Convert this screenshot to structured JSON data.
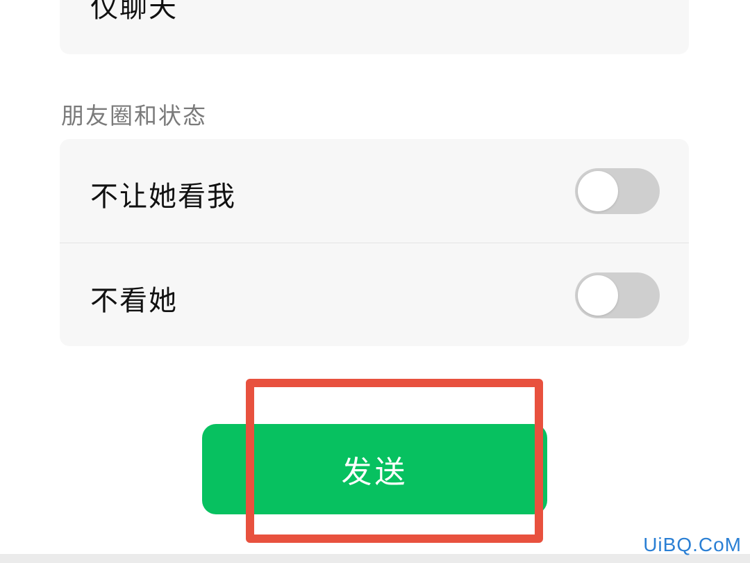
{
  "top_card": {
    "label": "仅聊天"
  },
  "moments_section": {
    "title": "朋友圈和状态",
    "rows": [
      {
        "label": "不让她看我",
        "toggle_on": false
      },
      {
        "label": "不看她",
        "toggle_on": false
      }
    ]
  },
  "send_button": {
    "label": "发送"
  },
  "watermark": {
    "text": "UiBQ.CoM"
  },
  "colors": {
    "accent_green": "#07c160",
    "highlight_red": "#e8513e",
    "toggle_off": "#cfcfcf"
  }
}
